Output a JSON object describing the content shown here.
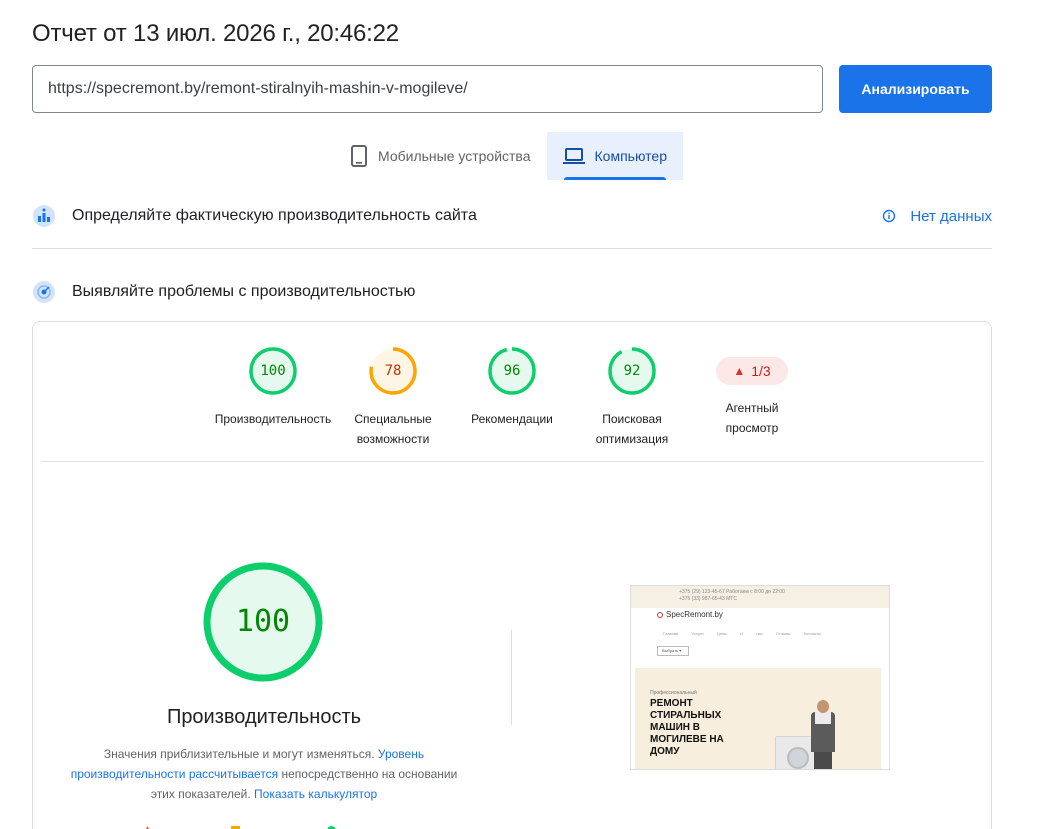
{
  "header": {
    "report_title": "Отчет от 13 июл. 2026 г., 20:46:22"
  },
  "url_bar": {
    "value": "https://specremont.by/remont-stiralnyih-mashin-v-mogileve/",
    "analyze_label": "Анализировать"
  },
  "device_tabs": [
    {
      "label": "Мобильные устройства",
      "icon": "smartphone-icon",
      "active": false
    },
    {
      "label": "Компьютер",
      "icon": "laptop-icon",
      "active": true
    }
  ],
  "field_data": {
    "label": "Определяйте фактическую производительность сайта",
    "status": "Нет данных"
  },
  "lab_data": {
    "label": "Выявляйте проблемы с производительностью"
  },
  "categories": [
    {
      "score": "100",
      "label_line1": "Производительность",
      "label_line2": "",
      "rating": "pass",
      "fraction": 1.0
    },
    {
      "score": "78",
      "label_line1": "Специальные",
      "label_line2": "возможности",
      "rating": "average",
      "fraction": 0.78
    },
    {
      "score": "96",
      "label_line1": "Рекомендации",
      "label_line2": "",
      "rating": "pass",
      "fraction": 0.96
    },
    {
      "score": "92",
      "label_line1": "Поисковая",
      "label_line2": "оптимизация",
      "rating": "pass",
      "fraction": 0.92
    }
  ],
  "agentic": {
    "badge": "1/3",
    "label_line1": "Агентный",
    "label_line2": "просмотр"
  },
  "performance": {
    "score": "100",
    "title": "Производительность",
    "note_text_1": "Значения приблизительные и могут изменяться. ",
    "note_link_1": "Уровень производительности рассчитывается",
    "note_text_2": " непосредственно на основании этих показателей. ",
    "note_link_2": "Показать калькулятор"
  },
  "screenshot_preview": {
    "top_line_1": "+375 (29) 123-45-67",
    "top_line_2": "+375 (33) 987-65-43 МТС",
    "top_note": "Работаем с 8:00 до 22:00",
    "logo": "SpecRemont.by",
    "nav": "Главная Услуги Цены О нас Отзывы Контакты",
    "picker": "Выбрать ▾",
    "sub": "Профессиональный",
    "heading": "РЕМОНТ СТИРАЛЬНЫХ МАШИН В МОГИЛЕВЕ НА ДОМУ"
  },
  "colors": {
    "accent": "#1a73e8",
    "pass": "#0cce6b",
    "average": "#ffa400",
    "fail": "#ff4e42"
  }
}
